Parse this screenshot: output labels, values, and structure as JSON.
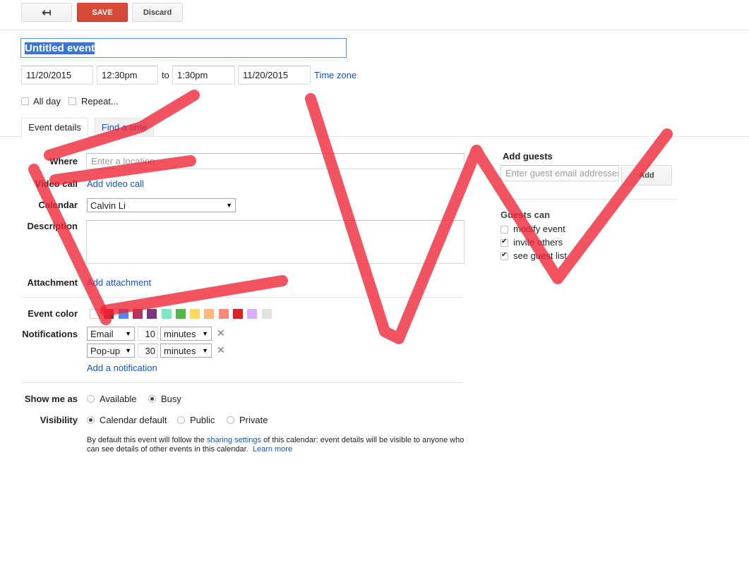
{
  "toolbar": {
    "back_icon": "back-arrow-icon",
    "save_label": "SAVE",
    "discard_label": "Discard"
  },
  "event": {
    "title": "Untitled event",
    "start_date": "11/20/2015",
    "start_time": "12:30pm",
    "to_label": "to",
    "end_time": "1:30pm",
    "end_date": "11/20/2015",
    "time_zone_link": "Time zone",
    "all_day_label": "All day",
    "repeat_label": "Repeat..."
  },
  "tabs": [
    {
      "label": "Event details"
    },
    {
      "label": "Find a time"
    }
  ],
  "details": {
    "where_label": "Where",
    "where_placeholder": "Enter a location",
    "video_call_label": "Video call",
    "video_call_link": "Add video call",
    "calendar_label": "Calendar",
    "calendar_value": "Calvin Li",
    "description_label": "Description",
    "attachment_label": "Attachment",
    "attachment_link": "Add attachment",
    "event_color_label": "Event color",
    "notifications_label": "Notifications",
    "notifications": [
      {
        "method": "Email",
        "amount": "10",
        "unit": "minutes"
      },
      {
        "method": "Pop-up",
        "amount": "30",
        "unit": "minutes"
      }
    ],
    "add_notification_link": "Add a notification",
    "show_me_as_label": "Show me as",
    "available_label": "Available",
    "busy_label": "Busy",
    "visibility_label": "Visibility",
    "visibility_default": "Calendar default",
    "visibility_public": "Public",
    "visibility_private": "Private",
    "visibility_note_1": "By default this event will follow the ",
    "visibility_note_link": "sharing settings",
    "visibility_note_2": " of this calendar: event details will be visible to anyone who",
    "visibility_note_3": "can see details of other events in this calendar.",
    "learn_more_link": "Learn more"
  },
  "colors": [
    "#a4bdfc",
    "#7ae7bf",
    "#dbadff",
    "#ff887c",
    "#fbd75b",
    "#ffb878",
    "#46d6db",
    "#e1e1e1",
    "#5484ed",
    "#51b749",
    "#dc2127",
    "#b99aff"
  ],
  "swatch_colors": [
    "#ffffff",
    "#a32929",
    "#5484ed",
    "#b1365f",
    "#7a367a",
    "#7ae7bf",
    "#51b749",
    "#fbd75b",
    "#ffb878",
    "#ff887c",
    "#dc2127",
    "#dbadff",
    "#e1e1e1"
  ],
  "guests": {
    "title": "Add guests",
    "input_placeholder": "Enter guest email addresses",
    "add_button": "Add",
    "guests_can_label": "Guests can",
    "permissions": [
      {
        "label": "modify event",
        "checked": false
      },
      {
        "label": "invite others",
        "checked": true
      },
      {
        "label": "see guest list",
        "checked": true
      }
    ]
  },
  "annotation_color": "#ee2233"
}
